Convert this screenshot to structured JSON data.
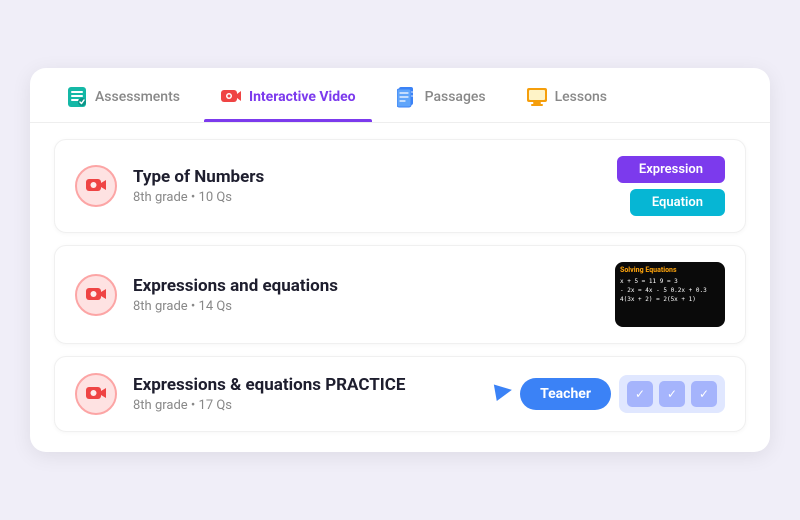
{
  "tabs": [
    {
      "id": "assessments",
      "label": "Assessments",
      "icon": "assessment",
      "active": false
    },
    {
      "id": "interactive-video",
      "label": "Interactive Video",
      "icon": "video",
      "active": true
    },
    {
      "id": "passages",
      "label": "Passages",
      "icon": "passages",
      "active": false
    },
    {
      "id": "lessons",
      "label": "Lessons",
      "icon": "lessons",
      "active": false
    }
  ],
  "items": [
    {
      "id": "type-of-numbers",
      "title": "Type of Numbers",
      "meta": "8th grade • 10 Qs",
      "actions": [
        "Expression",
        "Equation"
      ]
    },
    {
      "id": "expressions-equations",
      "title": "Expressions and equations",
      "meta": "8th grade • 14 Qs",
      "actions": [
        "thumbnail"
      ]
    },
    {
      "id": "expressions-practice",
      "title": "Expressions & equations PRACTICE",
      "meta": "8th grade • 17 Qs",
      "actions": [
        "teacher"
      ]
    }
  ],
  "teacher_label": "Teacher",
  "thumbnail_title": "Solving Equations",
  "thumbnail_lines": [
    "x + 5 = 11    9 = 3",
    "- 2x = 4x - 5   0.2x + 0.3",
    "4(3x + 2) = 2(5x + 1)"
  ]
}
